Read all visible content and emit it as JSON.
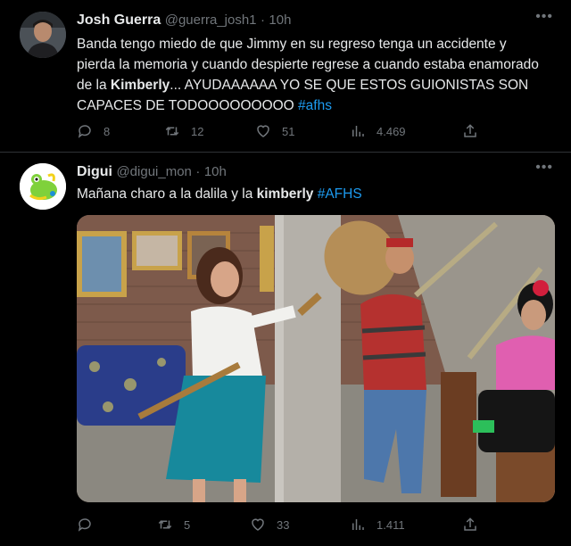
{
  "tweets": [
    {
      "name": "Josh Guerra",
      "handle": "@guerra_josh1",
      "separator": "·",
      "time": "10h",
      "text_before": "Banda tengo miedo de que Jimmy en su regreso tenga un accidente y pierda la memoria y cuando despierte regrese a cuando estaba enamorado de la ",
      "bold": "Kimberly",
      "text_after": "... AYUDAAAAAA YO SE QUE ESTOS GUIONISTAS SON CAPACES DE TODOOOOOOOOO ",
      "hashtag": "#afhs",
      "replies": "8",
      "retweets": "12",
      "likes": "51",
      "views": "4.469"
    },
    {
      "name": "Digui",
      "handle": "@digui_mon",
      "separator": "·",
      "time": "10h",
      "text_before": "Mañana charo a la dalila y la ",
      "bold": "kimberly",
      "text_after": " ",
      "hashtag": "#AFHS",
      "replies": "",
      "retweets": "5",
      "likes": "33",
      "views": "1.411"
    }
  ],
  "icons": {
    "more": "more-icon",
    "reply": "reply-icon",
    "retweet": "retweet-icon",
    "like": "heart-icon",
    "views": "views-icon",
    "share": "share-icon"
  },
  "colors": {
    "background": "#000000",
    "text": "#e7e9ea",
    "secondary": "#71767b",
    "link": "#1d9bf0",
    "divider": "#2f3336"
  }
}
